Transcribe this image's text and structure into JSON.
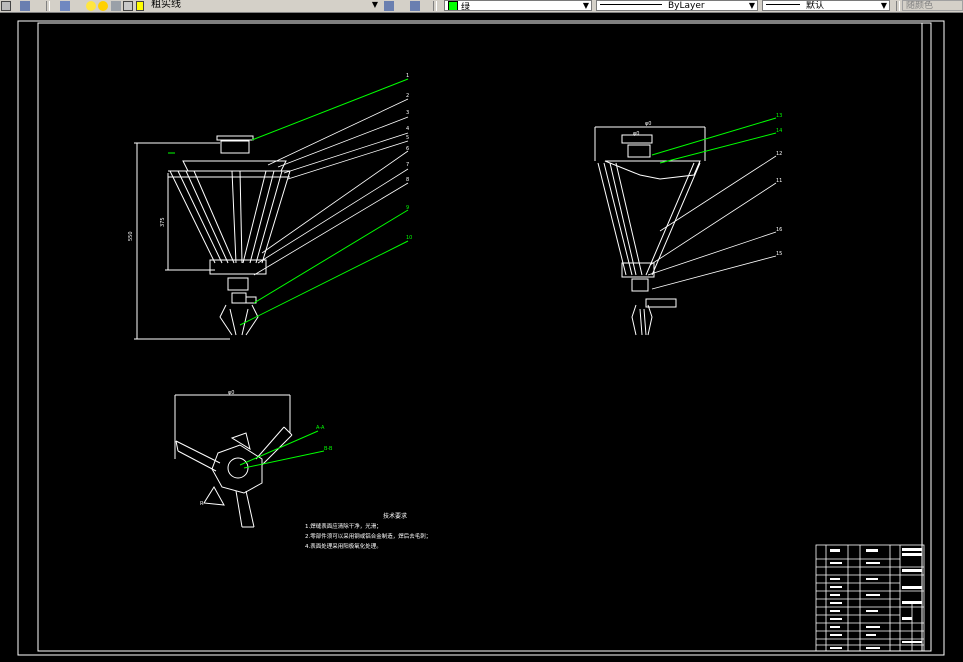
{
  "toolbar": {
    "layer_name": "粗实线",
    "color_value": "绿",
    "linetype_value": "ByLayer",
    "lineweight_value": "默认",
    "plotstyle_value": "随颜色"
  },
  "tech_requirements": {
    "title": "技术要求",
    "lines": [
      "1.焊缝表面应清除干净，光滑；",
      "2.零部件须可以采用钢或铝合金制造，焊后去毛刺；",
      "4.表面处理采用阳极氧化处理。"
    ]
  },
  "colors": {
    "background": "#000000",
    "geometry": "#ffffff",
    "leader": "#00ff00"
  }
}
